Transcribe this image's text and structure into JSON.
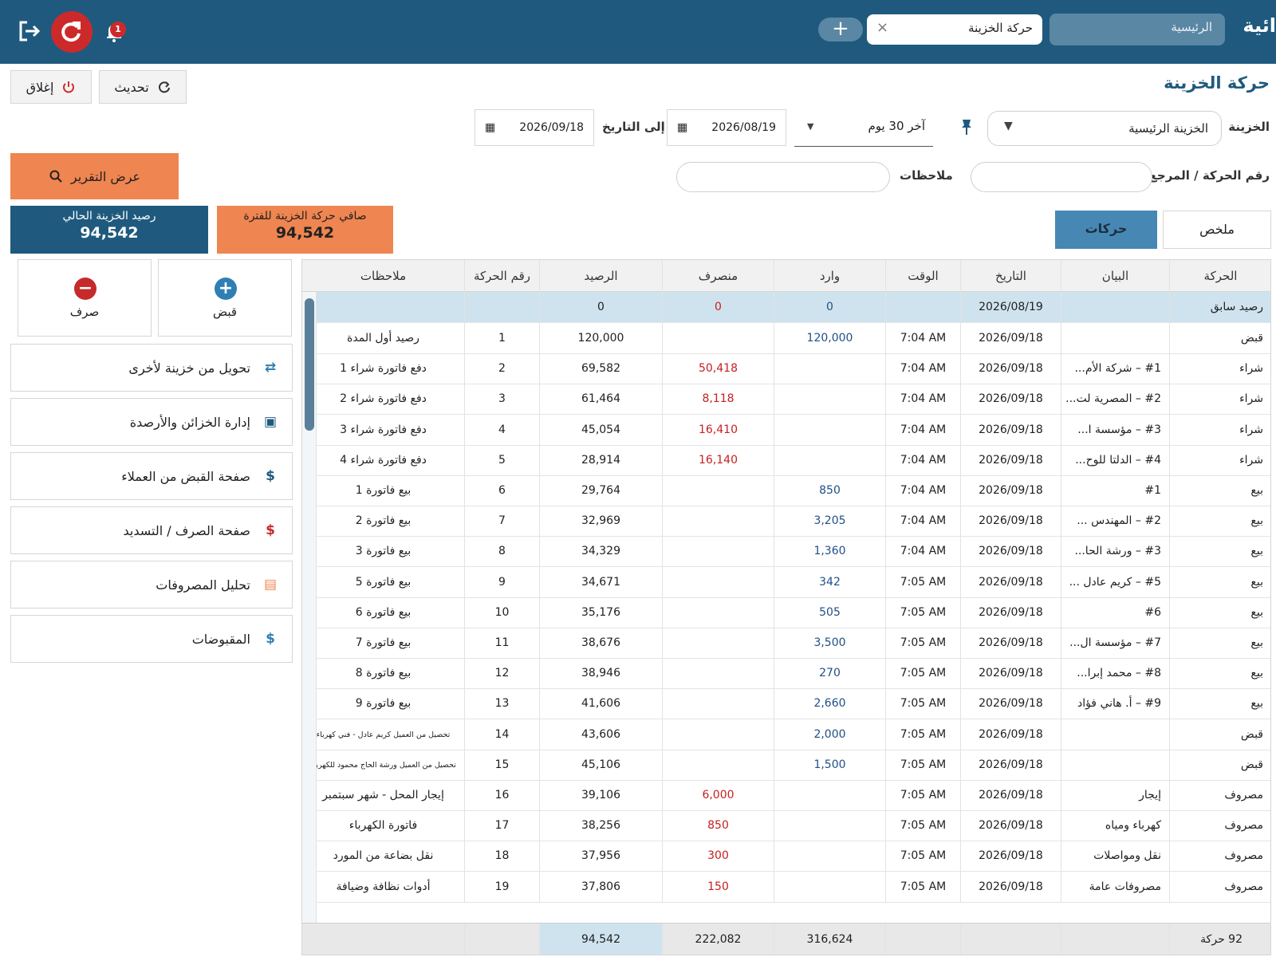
{
  "app": {
    "brand": "ائية",
    "tabs": [
      {
        "label": "الرئيسية"
      },
      {
        "label": "حركة الخزينة"
      }
    ],
    "new_tab_symbol": "+",
    "close_tab_symbol": "×",
    "notification_count": "1"
  },
  "page": {
    "title": "حركة الخزينة",
    "refresh_label": "تحديث",
    "close_label": "إغلاق"
  },
  "filters": {
    "treasury_label": "الخزينة",
    "treasury_value": "الخزينة الرئيسية",
    "period_value": "آخر 30 يوم",
    "from_date": "2026/08/19",
    "to_label": "إلى التاريخ",
    "to_date": "2026/09/18",
    "ref_label": "رقم الحركة / المرجع",
    "ref_value": "",
    "notes_label": "ملاحظات",
    "notes_value": "",
    "report_button": "عرض التقرير"
  },
  "summary": {
    "current_balance_label": "رصيد الخزينة الحالي",
    "current_balance_value": "94,542",
    "net_movement_label": "صافي حركة الخزينة للفترة",
    "net_movement_value": "94,542"
  },
  "view_toggle": {
    "summary_label": "ملخص",
    "movements_label": "حركات"
  },
  "side": {
    "receive_label": "قبض",
    "pay_label": "صرف",
    "links": [
      {
        "label": "تحويل من خزينة لأخرى",
        "icon": "transfer-icon"
      },
      {
        "label": "إدارة الخزائن والأرصدة",
        "icon": "wallet-icon"
      },
      {
        "label": "صفحة القبض من العملاء",
        "icon": "dollar-check-icon"
      },
      {
        "label": "صفحة الصرف / التسديد",
        "icon": "dollar-cross-icon"
      },
      {
        "label": "تحليل المصروفات",
        "icon": "report-icon"
      },
      {
        "label": "المقبوضات",
        "icon": "dollar-document-icon"
      }
    ]
  },
  "table": {
    "columns": [
      "الحركة",
      "البيان",
      "التاريخ",
      "الوقت",
      "وارد",
      "منصرف",
      "الرصيد",
      "رقم الحركة",
      "ملاحظات"
    ],
    "opening": {
      "type": "رصيد سابق",
      "date": "2026/08/19",
      "in": "0",
      "out": "0",
      "balance": "0"
    },
    "rows": [
      {
        "type": "قبض",
        "desc": "",
        "date": "2026/09/18",
        "time": "7:04 AM",
        "in": "120,000",
        "out": "",
        "balance": "120,000",
        "no": "1",
        "notes": "رصيد أول المدة"
      },
      {
        "type": "شراء",
        "desc": "#1 – شركة الأم...",
        "date": "2026/09/18",
        "time": "7:04 AM",
        "in": "",
        "out": "50,418",
        "balance": "69,582",
        "no": "2",
        "notes": "دفع فاتورة شراء 1"
      },
      {
        "type": "شراء",
        "desc": "#2 – المصرية لت...",
        "date": "2026/09/18",
        "time": "7:04 AM",
        "in": "",
        "out": "8,118",
        "balance": "61,464",
        "no": "3",
        "notes": "دفع فاتورة شراء 2"
      },
      {
        "type": "شراء",
        "desc": "#3 – مؤسسة ا...",
        "date": "2026/09/18",
        "time": "7:04 AM",
        "in": "",
        "out": "16,410",
        "balance": "45,054",
        "no": "4",
        "notes": "دفع فاتورة شراء 3"
      },
      {
        "type": "شراء",
        "desc": "#4 – الدلتا للوح...",
        "date": "2026/09/18",
        "time": "7:04 AM",
        "in": "",
        "out": "16,140",
        "balance": "28,914",
        "no": "5",
        "notes": "دفع فاتورة شراء 4"
      },
      {
        "type": "بيع",
        "desc": "#1",
        "date": "2026/09/18",
        "time": "7:04 AM",
        "in": "850",
        "out": "",
        "balance": "29,764",
        "no": "6",
        "notes": "بيع فاتورة 1"
      },
      {
        "type": "بيع",
        "desc": "#2 – المهندس ...",
        "date": "2026/09/18",
        "time": "7:04 AM",
        "in": "3,205",
        "out": "",
        "balance": "32,969",
        "no": "7",
        "notes": "بيع فاتورة 2"
      },
      {
        "type": "بيع",
        "desc": "#3 – ورشة الحا...",
        "date": "2026/09/18",
        "time": "7:04 AM",
        "in": "1,360",
        "out": "",
        "balance": "34,329",
        "no": "8",
        "notes": "بيع فاتورة 3"
      },
      {
        "type": "بيع",
        "desc": "#5 – كريم عادل ...",
        "date": "2026/09/18",
        "time": "7:05 AM",
        "in": "342",
        "out": "",
        "balance": "34,671",
        "no": "9",
        "notes": "بيع فاتورة 5"
      },
      {
        "type": "بيع",
        "desc": "#6",
        "date": "2026/09/18",
        "time": "7:05 AM",
        "in": "505",
        "out": "",
        "balance": "35,176",
        "no": "10",
        "notes": "بيع فاتورة 6"
      },
      {
        "type": "بيع",
        "desc": "#7 – مؤسسة ال...",
        "date": "2026/09/18",
        "time": "7:05 AM",
        "in": "3,500",
        "out": "",
        "balance": "38,676",
        "no": "11",
        "notes": "بيع فاتورة 7"
      },
      {
        "type": "بيع",
        "desc": "#8 – محمد إبرا...",
        "date": "2026/09/18",
        "time": "7:05 AM",
        "in": "270",
        "out": "",
        "balance": "38,946",
        "no": "12",
        "notes": "بيع فاتورة 8"
      },
      {
        "type": "بيع",
        "desc": "#9 – أ. هاني فؤاد",
        "date": "2026/09/18",
        "time": "7:05 AM",
        "in": "2,660",
        "out": "",
        "balance": "41,606",
        "no": "13",
        "notes": "بيع فاتورة 9"
      },
      {
        "type": "قبض",
        "desc": "",
        "date": "2026/09/18",
        "time": "7:05 AM",
        "in": "2,000",
        "out": "",
        "balance": "43,606",
        "no": "14",
        "notes": "تحصيل من العميل كريم عادل - فني كهرباء",
        "small": true
      },
      {
        "type": "قبض",
        "desc": "",
        "date": "2026/09/18",
        "time": "7:05 AM",
        "in": "1,500",
        "out": "",
        "balance": "45,106",
        "no": "15",
        "notes": "تحصيل من العميل ورشة الحاج محمود للكهرباء",
        "small": true
      },
      {
        "type": "مصروف",
        "desc": "إيجار",
        "date": "2026/09/18",
        "time": "7:05 AM",
        "in": "",
        "out": "6,000",
        "balance": "39,106",
        "no": "16",
        "notes": "إيجار المحل - شهر سبتمبر"
      },
      {
        "type": "مصروف",
        "desc": "كهرباء ومياه",
        "date": "2026/09/18",
        "time": "7:05 AM",
        "in": "",
        "out": "850",
        "balance": "38,256",
        "no": "17",
        "notes": "فاتورة الكهرباء"
      },
      {
        "type": "مصروف",
        "desc": "نقل ومواصلات",
        "date": "2026/09/18",
        "time": "7:05 AM",
        "in": "",
        "out": "300",
        "balance": "37,956",
        "no": "18",
        "notes": "نقل بضاعة من المورد"
      },
      {
        "type": "مصروف",
        "desc": "مصروفات عامة",
        "date": "2026/09/18",
        "time": "7:05 AM",
        "in": "",
        "out": "150",
        "balance": "37,806",
        "no": "19",
        "notes": "أدوات نظافة وضيافة"
      }
    ],
    "footer": {
      "count": "92 حركة",
      "in_total": "316,624",
      "out_total": "222,082",
      "balance": "94,542"
    }
  }
}
